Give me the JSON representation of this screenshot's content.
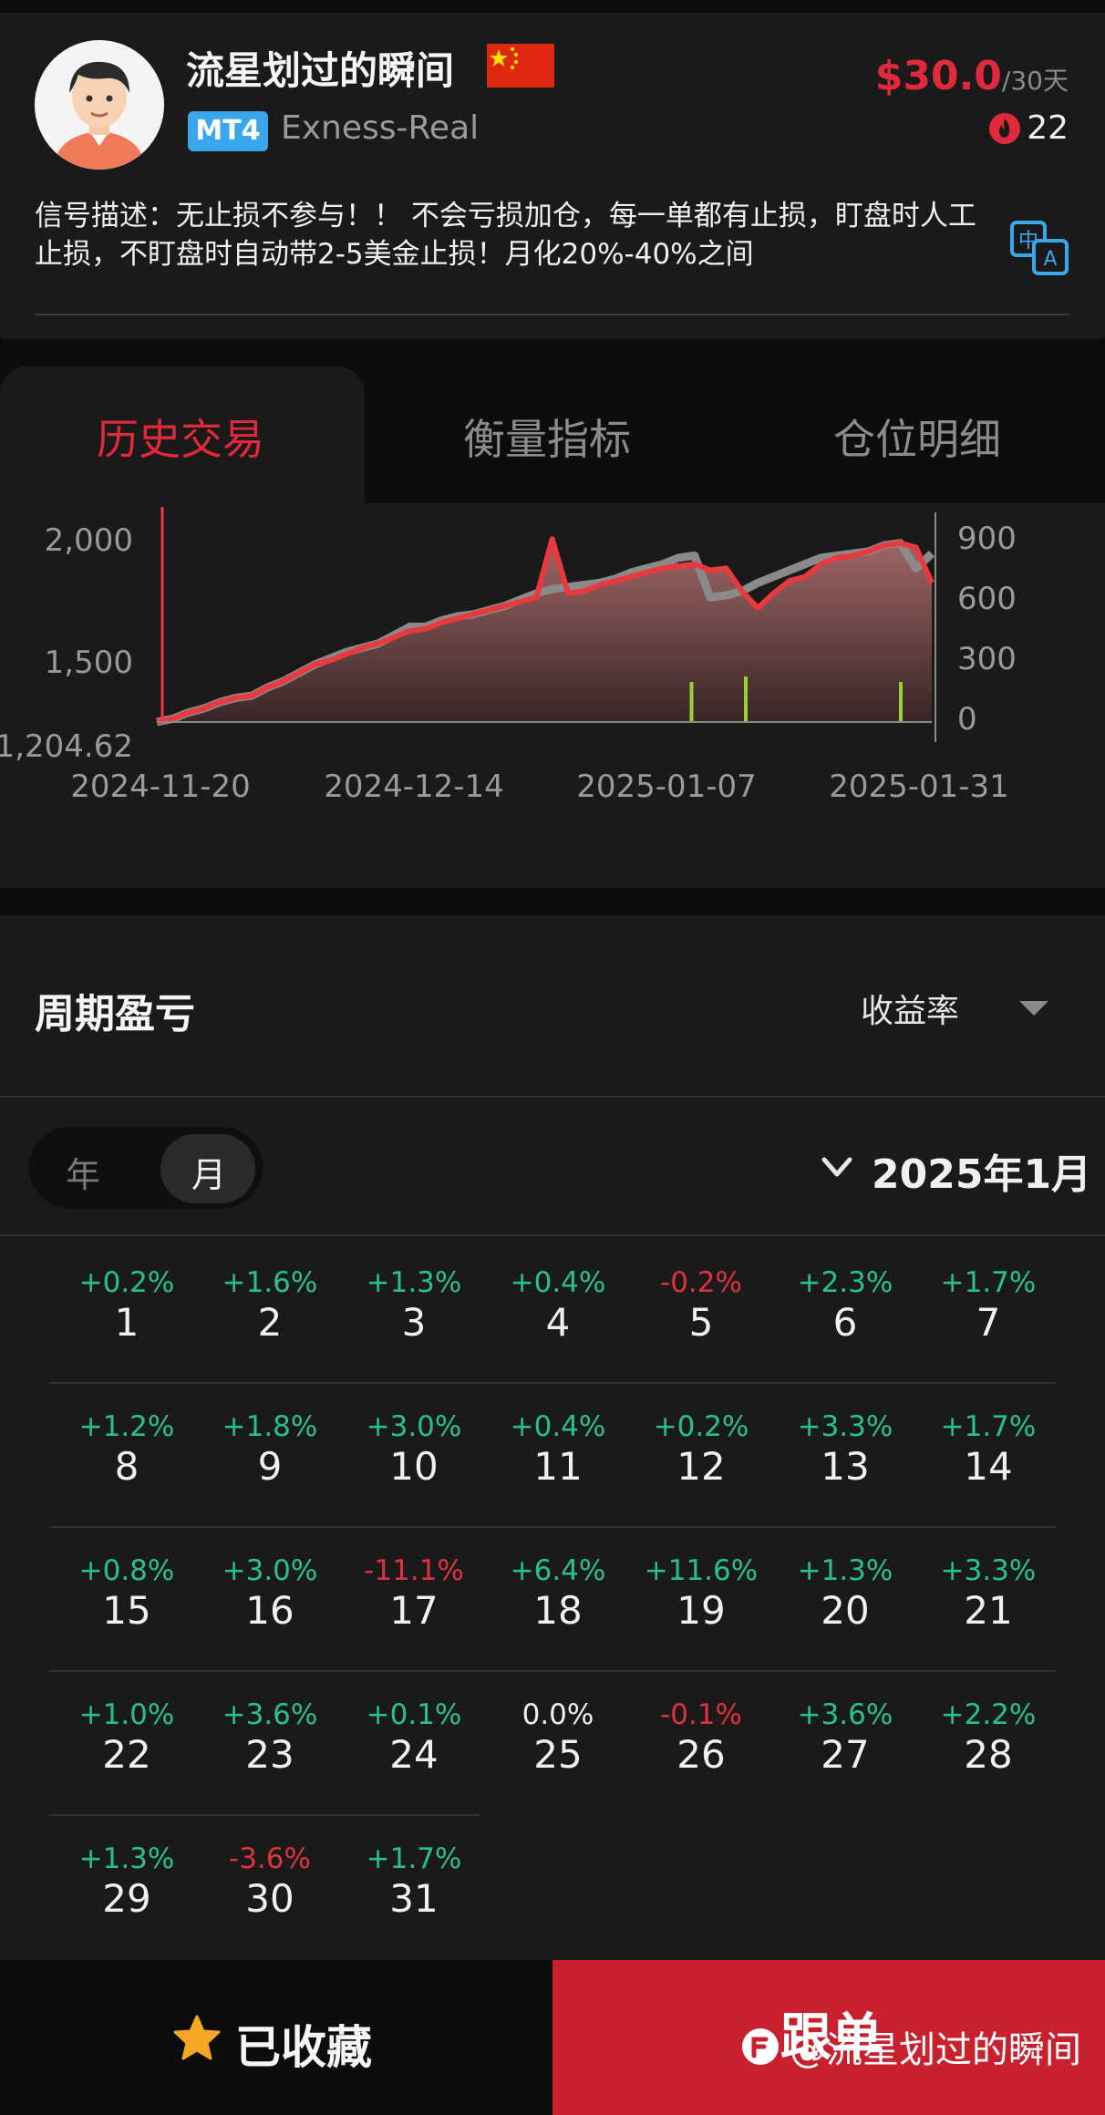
{
  "profile": {
    "name": "流星划过的瞬间",
    "platform_badge": "MT4",
    "broker": "Exness-Real",
    "price": "$30.0",
    "price_unit": "/30天",
    "fans": "22",
    "description": "信号描述：无止损不参与！！ 不会亏损加仓，每一单都有止损，盯盘时人工止损，不盯盘时自动带2-5美金止损！月化20%-40%之间"
  },
  "tabs": [
    {
      "label": "历史交易",
      "active": true
    },
    {
      "label": "衡量指标",
      "active": false
    },
    {
      "label": "仓位明细",
      "active": false
    }
  ],
  "chart_data": {
    "type": "area",
    "x_ticks": [
      "2024-11-20",
      "2024-12-14",
      "2025-01-07",
      "2025-01-31"
    ],
    "y_left_ticks": [
      "2,000",
      "1,500",
      "1,204.62"
    ],
    "y_right_ticks": [
      "900",
      "600",
      "300",
      "0"
    ],
    "y_left_range": [
      1204.62,
      2120
    ],
    "series": [
      {
        "color": "#e8393f",
        "values": [
          1205,
          1220,
          1250,
          1270,
          1300,
          1320,
          1330,
          1370,
          1400,
          1440,
          1480,
          1500,
          1530,
          1560,
          1580,
          1610,
          1640,
          1650,
          1680,
          1700,
          1720,
          1740,
          1760,
          1780,
          1800,
          2080,
          1820,
          1830,
          1860,
          1880,
          1900,
          1920,
          1940,
          1950,
          1960,
          1930,
          1940,
          1830,
          1750,
          1820,
          1880,
          1900,
          1960,
          1990,
          2000,
          2020,
          2050,
          2060,
          2040,
          1870
        ]
      },
      {
        "color": "#8a8a8a",
        "values": [
          1205,
          1220,
          1250,
          1270,
          1300,
          1320,
          1330,
          1370,
          1400,
          1440,
          1480,
          1510,
          1540,
          1560,
          1580,
          1620,
          1660,
          1660,
          1690,
          1710,
          1720,
          1740,
          1760,
          1790,
          1820,
          1840,
          1850,
          1860,
          1870,
          1890,
          1920,
          1940,
          1960,
          1990,
          2000,
          1800,
          1810,
          1830,
          1870,
          1900,
          1930,
          1960,
          1990,
          2000,
          2010,
          2020,
          2050,
          2060,
          1940,
          2010
        ]
      }
    ],
    "volume_bars": [
      [
        0.69,
        220
      ],
      [
        0.76,
        250
      ],
      [
        0.96,
        220
      ]
    ]
  },
  "pnl": {
    "title": "周期盈亏",
    "metric_select": "收益率",
    "seg_year": "年",
    "seg_month": "月",
    "period": "2025年1月",
    "days": [
      {
        "day": "1",
        "pct": "+0.2%"
      },
      {
        "day": "2",
        "pct": "+1.6%"
      },
      {
        "day": "3",
        "pct": "+1.3%"
      },
      {
        "day": "4",
        "pct": "+0.4%"
      },
      {
        "day": "5",
        "pct": "-0.2%"
      },
      {
        "day": "6",
        "pct": "+2.3%"
      },
      {
        "day": "7",
        "pct": "+1.7%"
      },
      {
        "day": "8",
        "pct": "+1.2%"
      },
      {
        "day": "9",
        "pct": "+1.8%"
      },
      {
        "day": "10",
        "pct": "+3.0%"
      },
      {
        "day": "11",
        "pct": "+0.4%"
      },
      {
        "day": "12",
        "pct": "+0.2%"
      },
      {
        "day": "13",
        "pct": "+3.3%"
      },
      {
        "day": "14",
        "pct": "+1.7%"
      },
      {
        "day": "15",
        "pct": "+0.8%"
      },
      {
        "day": "16",
        "pct": "+3.0%"
      },
      {
        "day": "17",
        "pct": "-11.1%"
      },
      {
        "day": "18",
        "pct": "+6.4%"
      },
      {
        "day": "19",
        "pct": "+11.6%"
      },
      {
        "day": "20",
        "pct": "+1.3%"
      },
      {
        "day": "21",
        "pct": "+3.3%"
      },
      {
        "day": "22",
        "pct": "+1.0%"
      },
      {
        "day": "23",
        "pct": "+3.6%"
      },
      {
        "day": "24",
        "pct": "+0.1%"
      },
      {
        "day": "25",
        "pct": "0.0%"
      },
      {
        "day": "26",
        "pct": "-0.1%"
      },
      {
        "day": "27",
        "pct": "+3.6%"
      },
      {
        "day": "28",
        "pct": "+2.2%"
      },
      {
        "day": "29",
        "pct": "+1.3%"
      },
      {
        "day": "30",
        "pct": "-3.6%"
      },
      {
        "day": "31",
        "pct": "+1.7%"
      }
    ]
  },
  "bottom": {
    "favorite_label": "已收藏",
    "follow_label": "跟单",
    "watermark": "@流星划过的瞬间"
  },
  "colors": {
    "accent_red": "#e02a3c",
    "gain_green": "#27c191",
    "loss_red": "#e0323e",
    "badge_blue": "#3aa7ec"
  }
}
